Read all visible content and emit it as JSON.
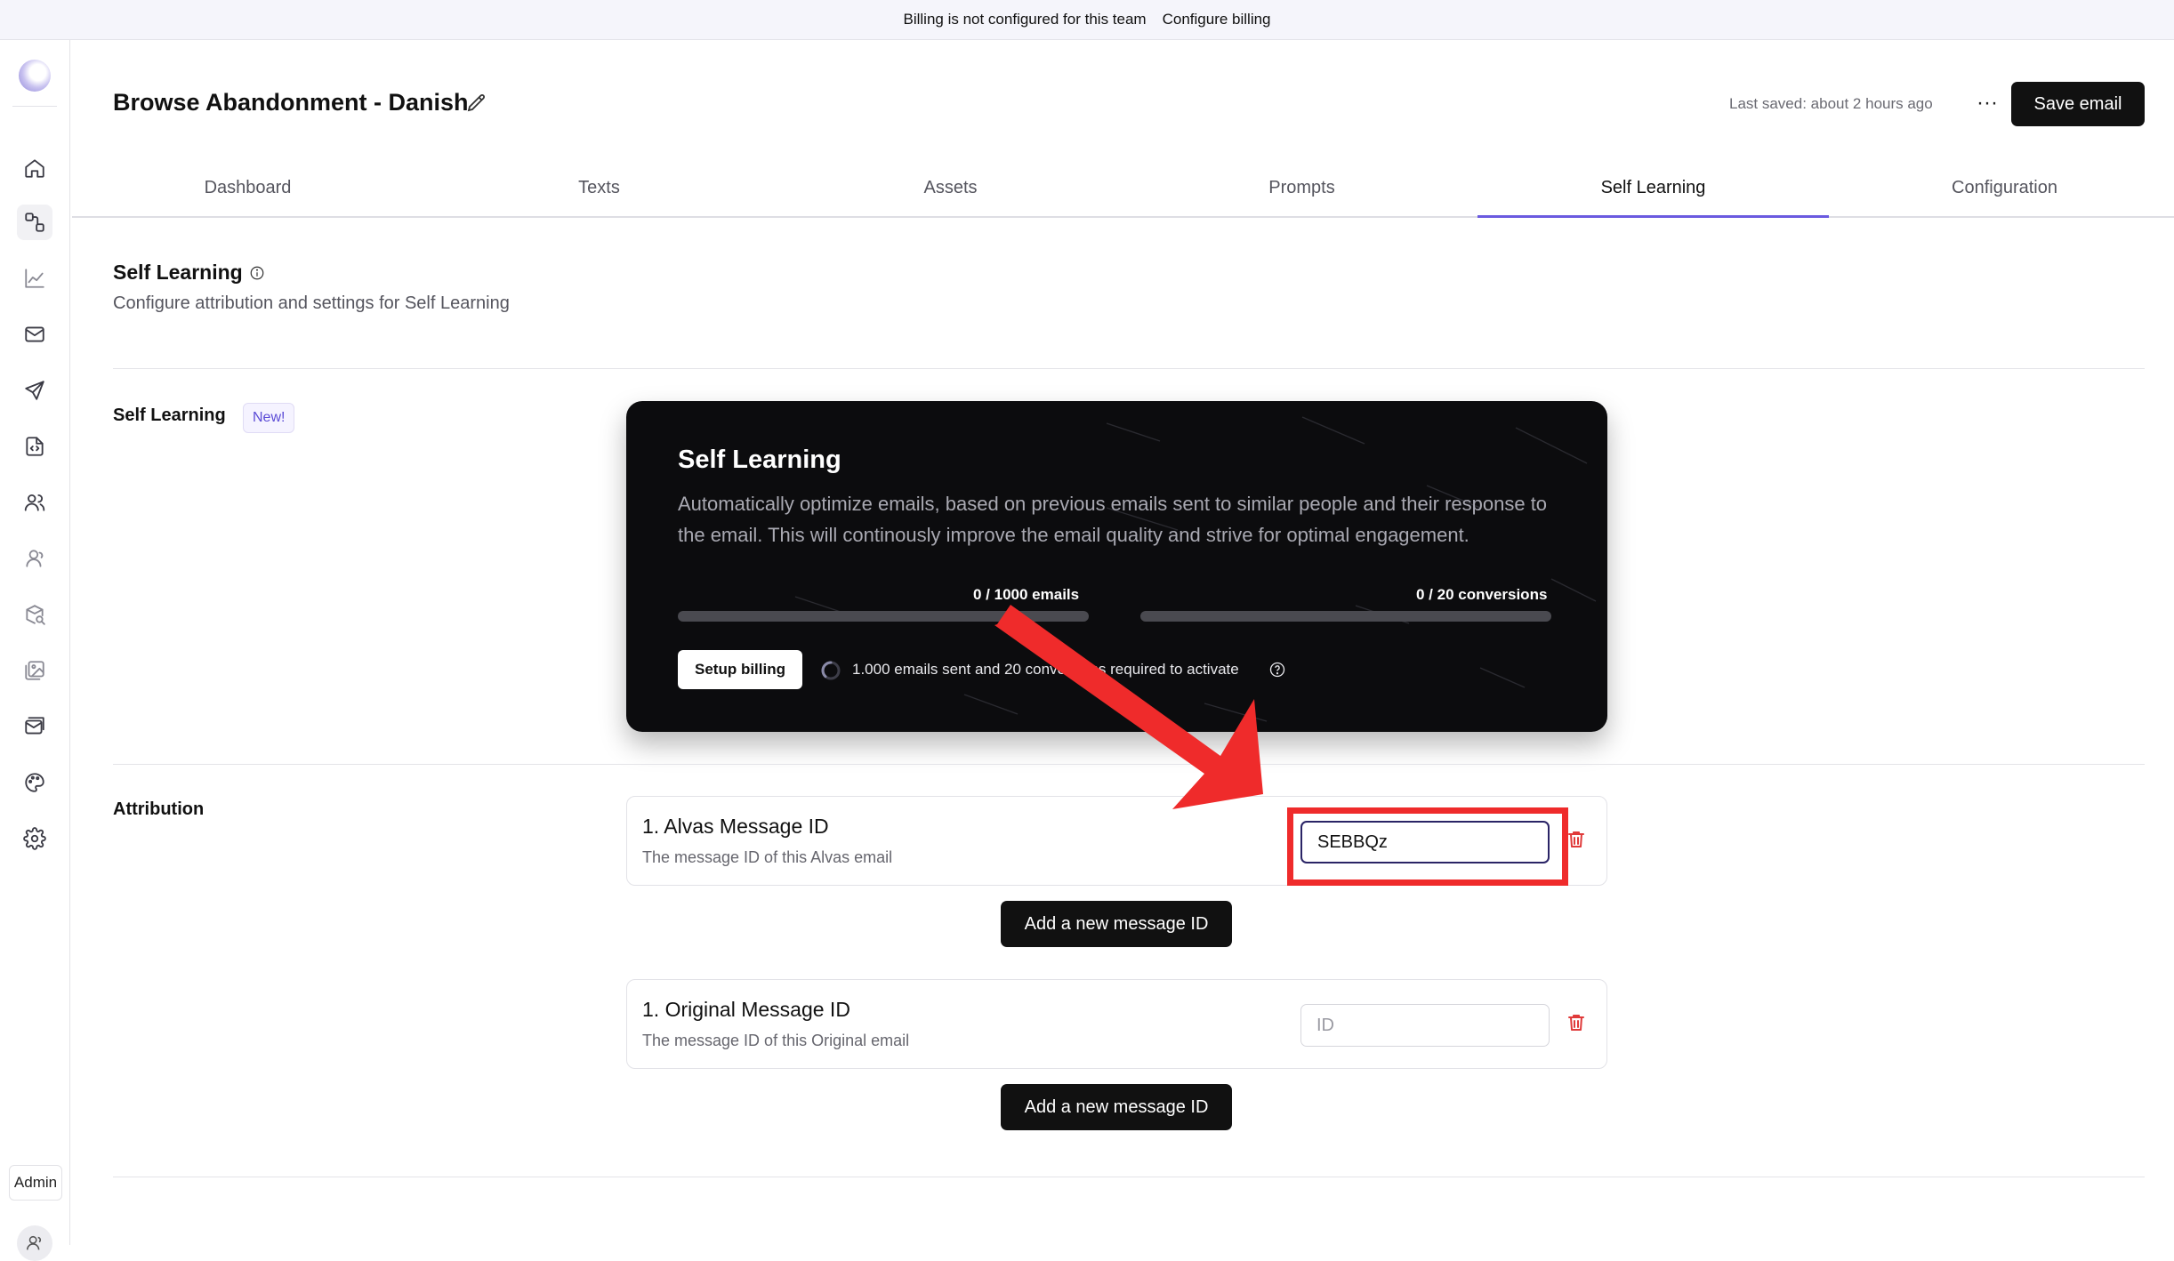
{
  "banner": {
    "message": "Billing is not configured for this team",
    "link": "Configure billing"
  },
  "sidebar": {
    "items": [
      {
        "icon": "home-icon"
      },
      {
        "icon": "flows-icon",
        "active": true
      },
      {
        "icon": "analytics-icon"
      },
      {
        "icon": "mail-icon"
      },
      {
        "icon": "send-icon"
      },
      {
        "icon": "code-file-icon"
      },
      {
        "icon": "users-icon"
      },
      {
        "icon": "contacts-icon"
      },
      {
        "icon": "product-search-icon"
      },
      {
        "icon": "gallery-icon"
      },
      {
        "icon": "inbox-icon"
      },
      {
        "icon": "palette-icon"
      },
      {
        "icon": "gear-icon"
      }
    ],
    "admin_label": "Admin"
  },
  "header": {
    "title": "Browse Abandonment - Danish",
    "last_saved": "Last saved: about 2 hours ago",
    "more_label": "···",
    "save_label": "Save email"
  },
  "tabs": [
    {
      "label": "Dashboard"
    },
    {
      "label": "Texts"
    },
    {
      "label": "Assets"
    },
    {
      "label": "Prompts"
    },
    {
      "label": "Self Learning",
      "active": true
    },
    {
      "label": "Configuration"
    }
  ],
  "section": {
    "title": "Self Learning",
    "subtitle": "Configure attribution and settings for Self Learning"
  },
  "self_learning_row": {
    "label": "Self Learning",
    "badge": "New!"
  },
  "card": {
    "title": "Self Learning",
    "description": "Automatically optimize emails, based on previous emails sent to similar people and their response to the email. This will continously improve the email quality and strive for optimal engagement.",
    "progress_emails": {
      "label": "0 / 1000 emails",
      "value": 0,
      "max": 1000
    },
    "progress_conversions": {
      "label": "0 / 20 conversions",
      "value": 0,
      "max": 20
    },
    "setup_button": "Setup billing",
    "requirement": "1.000 emails sent and 20 conversions required to activate"
  },
  "attribution": {
    "label": "Attribution",
    "alvas": {
      "title": "1. Alvas Message ID",
      "subtitle": "The message ID of this Alvas email",
      "value": "SEBBQz",
      "placeholder": "ID"
    },
    "original": {
      "title": "1. Original Message ID",
      "subtitle": "The message ID of this Original email",
      "value": "",
      "placeholder": "ID"
    },
    "add_button": "Add a new message ID"
  },
  "colors": {
    "accent": "#6a5ae0",
    "annotation": "#ef2b2b",
    "danger": "#e03a3a",
    "card_bg": "#0c0c0e"
  }
}
